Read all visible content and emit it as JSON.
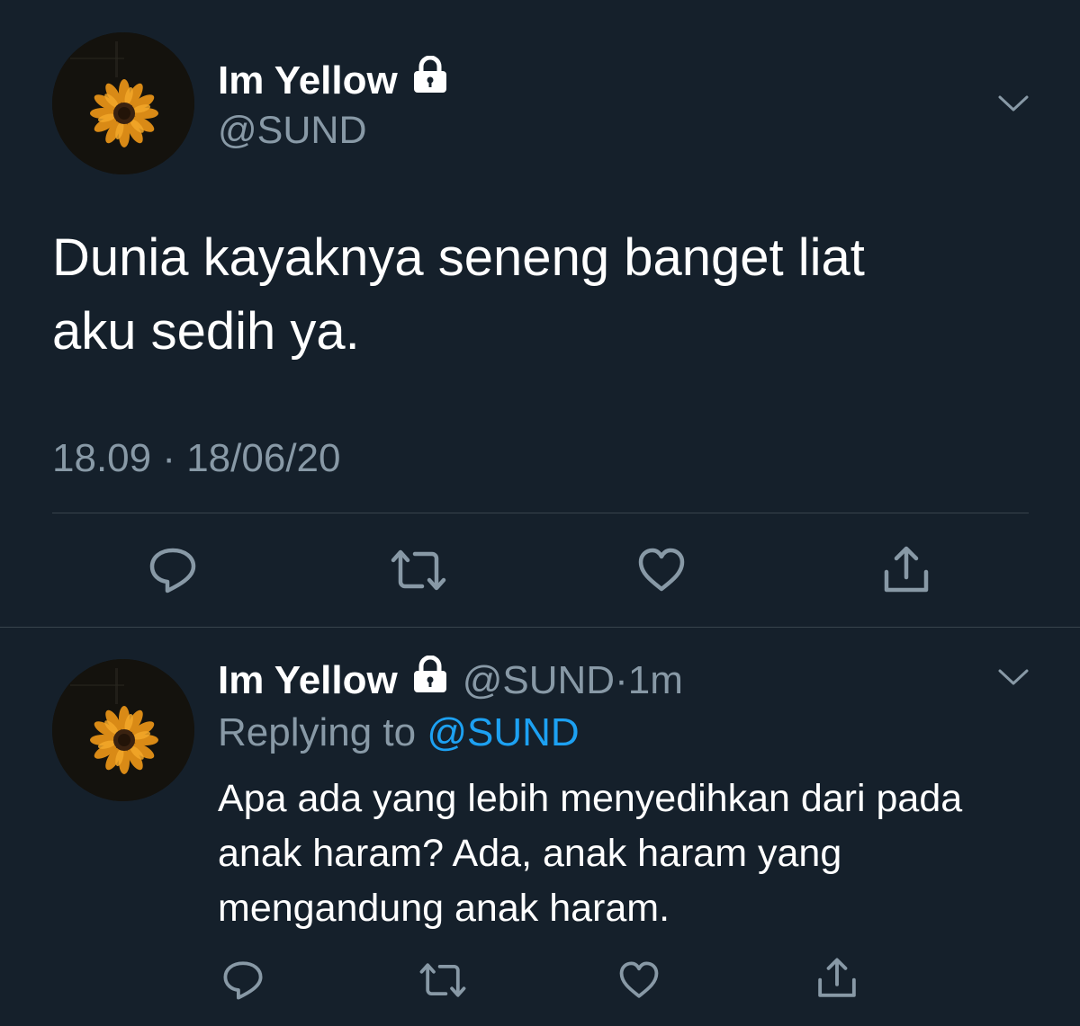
{
  "colors": {
    "background": "#15202b",
    "primary_text": "#ffffff",
    "secondary_text": "#8899a6",
    "link": "#1da1f2",
    "divider": "#38444d"
  },
  "main_tweet": {
    "display_name": "Im Yellow",
    "handle": "@SUND",
    "protected_icon": "lock-icon",
    "menu_icon": "chevron-down-icon",
    "text_line1": "Dunia kayaknya seneng banget liat",
    "text_line2": "aku sedih ya.",
    "timestamp": "18.09 · 18/06/20",
    "actions": [
      "reply-icon",
      "retweet-icon",
      "like-icon",
      "share-icon"
    ]
  },
  "reply_tweet": {
    "display_name": "Im Yellow",
    "handle": "@SUND",
    "separator": " · ",
    "age": "1m",
    "protected_icon": "lock-icon",
    "menu_icon": "chevron-down-icon",
    "replying_prefix": "Replying to ",
    "replying_handle": "@SUND",
    "text_line1": "Apa ada yang lebih menyedihkan dari pada",
    "text_line2": "anak haram? Ada, anak haram yang",
    "text_line3": "mengandung anak haram.",
    "actions": [
      "reply-icon",
      "retweet-icon",
      "like-icon",
      "share-icon"
    ]
  }
}
